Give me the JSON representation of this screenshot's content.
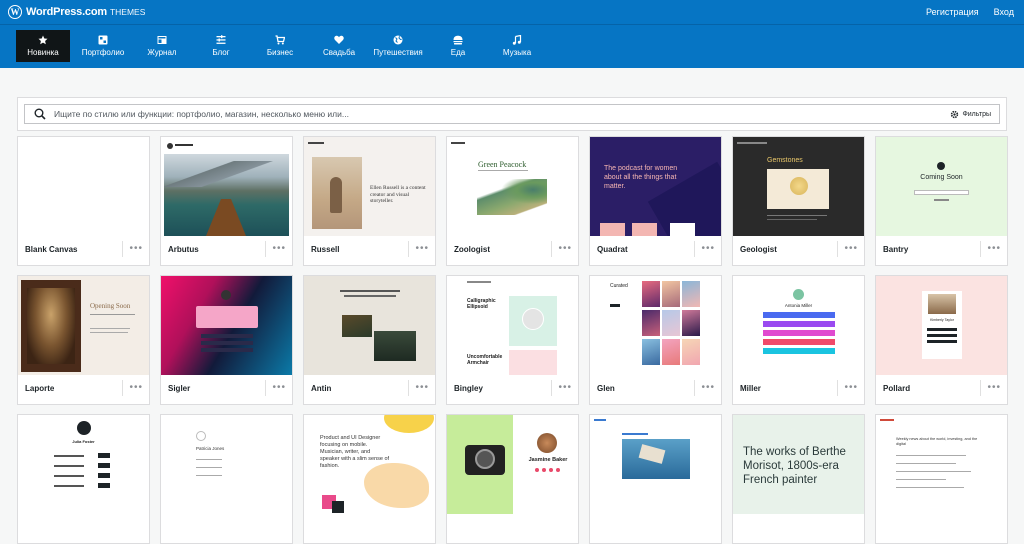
{
  "brand": {
    "name": "WordPress.com",
    "sub": "THEMES"
  },
  "top_links": {
    "register": "Регистрация",
    "login": "Вход"
  },
  "categories": [
    {
      "label": "Новинка",
      "icon": "star-icon",
      "active": true
    },
    {
      "label": "Портфолио",
      "icon": "portfolio-icon"
    },
    {
      "label": "Журнал",
      "icon": "magazine-icon"
    },
    {
      "label": "Блог",
      "icon": "blog-icon"
    },
    {
      "label": "Бизнес",
      "icon": "cart-icon"
    },
    {
      "label": "Свадьба",
      "icon": "heart-icon"
    },
    {
      "label": "Путешествия",
      "icon": "globe-icon"
    },
    {
      "label": "Еда",
      "icon": "food-icon"
    },
    {
      "label": "Музыка",
      "icon": "music-icon"
    }
  ],
  "search": {
    "placeholder": "Ищите по стилю или функции: портфолио, магазин, несколько меню или...",
    "filters_label": "Фильтры"
  },
  "more_label": "•••",
  "themes": [
    {
      "name": "Blank Canvas"
    },
    {
      "name": "Arbutus"
    },
    {
      "name": "Russell"
    },
    {
      "name": "Zoologist"
    },
    {
      "name": "Quadrat"
    },
    {
      "name": "Geologist"
    },
    {
      "name": "Bantry"
    },
    {
      "name": "Laporte"
    },
    {
      "name": "Sigler"
    },
    {
      "name": "Antin"
    },
    {
      "name": "Bingley"
    },
    {
      "name": "Glen"
    },
    {
      "name": "Miller"
    },
    {
      "name": "Pollard"
    },
    {
      "name": ""
    },
    {
      "name": ""
    },
    {
      "name": ""
    },
    {
      "name": ""
    },
    {
      "name": ""
    },
    {
      "name": ""
    },
    {
      "name": ""
    }
  ],
  "previews": {
    "russell_text": "Ellen Russell is a content creator and visual storyteller.",
    "zoologist_title": "Green Peacock",
    "quadrat_text": "The podcast for women about all the things that matter.",
    "geologist_title": "Gemstones",
    "bantry_title": "Coming Soon",
    "laporte_title": "Opening Soon",
    "bingley_t1": "Calligraphic Ellipsoid",
    "bingley_t2": "Uncomfortable Armchair",
    "glen_title": "Curated",
    "miller_name": "Antonia Miller",
    "pollard_name": "Kimberly Taylor",
    "row3_a_name": "Julia Foster",
    "row3_b_name": "Patricia Jones",
    "row3_c_text": "Product and UI Designer focusing on mobile. Musician, writer, and speaker with a slim sense of fashion.",
    "row3_d_name": "Jasmine Baker",
    "row3_f_text": "The works of Berthe Morisot, 1800s-era French painter",
    "row3_g_text": "Weekly news about the world, investing, and the digital"
  }
}
